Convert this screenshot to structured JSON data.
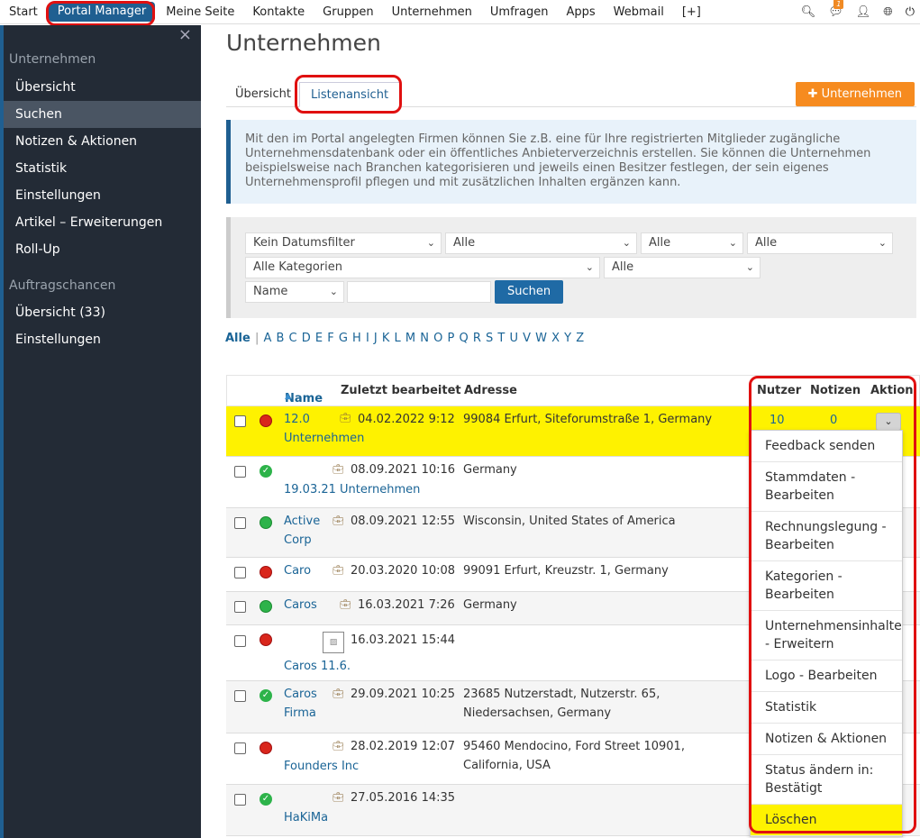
{
  "nav": {
    "items": [
      "Start",
      "Portal Manager",
      "Meine Seite",
      "Kontakte",
      "Gruppen",
      "Unternehmen",
      "Umfragen",
      "Apps",
      "Webmail",
      "[+]"
    ],
    "badge": "1",
    "icons": [
      "search-icon",
      "chat-icon",
      "user-icon",
      "globe-icon",
      "power-icon"
    ]
  },
  "sidebar": {
    "section1": "Unternehmen",
    "items1": [
      "Übersicht",
      "Suchen",
      "Notizen & Aktionen",
      "Statistik",
      "Einstellungen",
      "Artikel – Erweiterungen",
      "Roll-Up"
    ],
    "section2": "Auftragschancen",
    "items2": [
      "Übersicht (33)",
      "Einstellungen"
    ]
  },
  "page": {
    "title": "Unternehmen",
    "tab_overview": "Übersicht",
    "tab_list": "Listenansicht",
    "add_button": "Unternehmen",
    "info": "Mit den im Portal angelegten Firmen können Sie z.B. eine für Ihre registrierten Mitglieder zugängliche Unternehmensdatenbank oder ein öffentliches Anbieterverzeichnis erstellen. Sie können die Unternehmen beispielsweise nach Branchen kategorisieren und jeweils einen Besitzer festlegen, der sein eigenes Unternehmensprofil pflegen und mit zusätzlichen Inhalten ergänzen kann."
  },
  "filter": {
    "date": "Kein Datumsfilter",
    "all1": "Alle",
    "all2": "Alle",
    "all3": "Alle",
    "categories": "Alle Kategorien",
    "all4": "Alle",
    "field": "Name",
    "search_value": "",
    "search_button": "Suchen"
  },
  "alphabet": {
    "all": "Alle",
    "sep": "|",
    "letters": "A B C D E F G H I J K L M N O P Q R S T U V W X Y Z"
  },
  "table": {
    "headers": {
      "name": "Name",
      "edited": "Zuletzt bearbeitet",
      "address": "Adresse",
      "users": "Nutzer",
      "notes": "Notizen",
      "action": "Aktion"
    },
    "rows": [
      {
        "name1": "12.0",
        "name2": "Unternehmen",
        "date": "04.02.2022 9:12",
        "addr1": "99084 Erfurt, Siteforumstraße 1, Germany",
        "addr2": "",
        "users": "10",
        "notes": "0",
        "status": "red"
      },
      {
        "name1": "",
        "name2": "19.03.21 Unternehmen",
        "date": "08.09.2021 10:16",
        "addr1": "Germany",
        "addr2": "",
        "status": "check"
      },
      {
        "name1": "Active",
        "name2": "Corp",
        "date": "08.09.2021 12:55",
        "addr1": "Wisconsin, United States of America",
        "addr2": "",
        "status": "green"
      },
      {
        "name1": "Caro",
        "name2": "",
        "date": "20.03.2020 10:08",
        "addr1": "99091 Erfurt, Kreuzstr. 1, Germany",
        "addr2": "",
        "status": "red"
      },
      {
        "name1": "Caros",
        "name2": "",
        "date": "16.03.2021 7:26",
        "addr1": "Germany",
        "addr2": "",
        "status": "green"
      },
      {
        "name1": "",
        "name2": "Caros 11.6.",
        "date": "16.03.2021 15:44",
        "addr1": "",
        "addr2": "",
        "status": "red"
      },
      {
        "name1": "Caros",
        "name2": "Firma",
        "date": "29.09.2021 10:25",
        "addr1": "23685 Nutzerstadt, Nutzerstr. 65,",
        "addr2": "Niedersachsen, Germany",
        "status": "check"
      },
      {
        "name1": "",
        "name2": "Founders Inc",
        "date": "28.02.2019 12:07",
        "addr1": "95460 Mendocino, Ford Street 10901,",
        "addr2": "California, USA",
        "status": "red"
      },
      {
        "name1": "",
        "name2": "HaKiMa",
        "date": "27.05.2016 14:35",
        "addr1": "",
        "addr2": "",
        "status": "check"
      }
    ]
  },
  "menu": {
    "items": [
      "Feedback senden",
      "Stammdaten - Bearbeiten",
      "Rechnungslegung - Bearbeiten",
      "Kategorien - Bearbeiten",
      "Unternehmensinhalte - Erweitern",
      "Logo - Bearbeiten",
      "Statistik",
      "Notizen & Aktionen",
      "Status ändern in: Bestätigt",
      "Löschen"
    ]
  },
  "colors": {
    "accent": "#1f5f91",
    "orange": "#f68b1f",
    "highlight": "#fef200",
    "annotation": "#e01010"
  }
}
